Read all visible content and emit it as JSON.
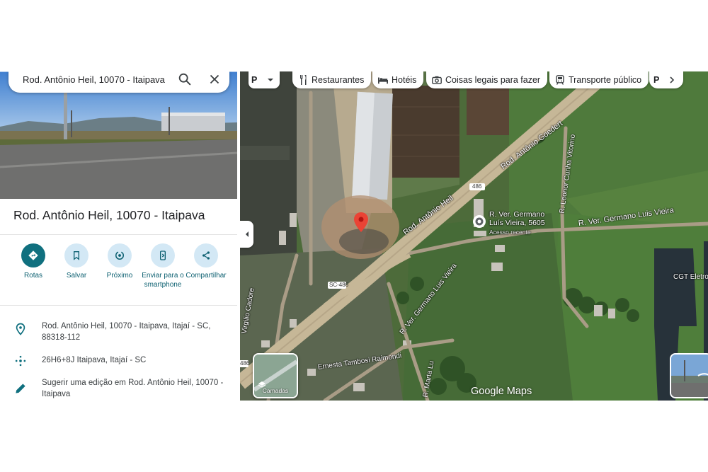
{
  "search": {
    "query": "Rod. Antônio Heil, 10070 - Itaipava"
  },
  "place": {
    "title": "Rod. Antônio Heil, 10070 - Itaipava"
  },
  "actions": [
    {
      "label": "Rotas"
    },
    {
      "label": "Salvar"
    },
    {
      "label": "Próximo"
    },
    {
      "label": "Enviar para o smartphone"
    },
    {
      "label": "Compartilhar"
    }
  ],
  "info": {
    "address": "Rod. Antônio Heil, 10070 - Itaipava, Itajaí - SC, 88318-112",
    "plus_code": "26H6+8J Itaipava, Itajaí - SC",
    "suggest_edit": "Sugerir uma edição em Rod. Antônio Heil, 10070 - Itaipava"
  },
  "map": {
    "chips": [
      {
        "label": "Restaurantes",
        "icon": "fork-knife-icon"
      },
      {
        "label": "Hotéis",
        "icon": "bed-icon"
      },
      {
        "label": "Coisas legais para fazer",
        "icon": "camera-icon"
      },
      {
        "label": "Transporte público",
        "icon": "train-icon"
      }
    ],
    "parking_chip": "P",
    "more_chip": "P",
    "labels": {
      "road_heil": "Rod. Antônio Heil",
      "road_goedert": "Rod. Antônio Goedert",
      "road_leonor": "R. Leonor Cunha Vitorino",
      "road_germano": "R. Ver. Germano Luis Vieira",
      "road_germano_lower": "R. Ver. Germano Luis Vieira",
      "road_tambosi": "Ernesta Tambosi Raimondi",
      "road_marta": "R. Marta Lu",
      "road_cadore": "Virgilio Cadore",
      "poi_name": "R. Ver. Germano Luís Vieira, 5605",
      "poi_sub": "Acesso recente",
      "cgt": "CGT Eletro",
      "shield_486": "486",
      "shield_sc486": "SC-486",
      "shield_486b": "486"
    },
    "layers_label": "Camadas",
    "wordmark": "Google Maps"
  },
  "colors": {
    "accent": "#10707f",
    "pin": "#ea4335",
    "chip_bg": "#ffffff"
  }
}
